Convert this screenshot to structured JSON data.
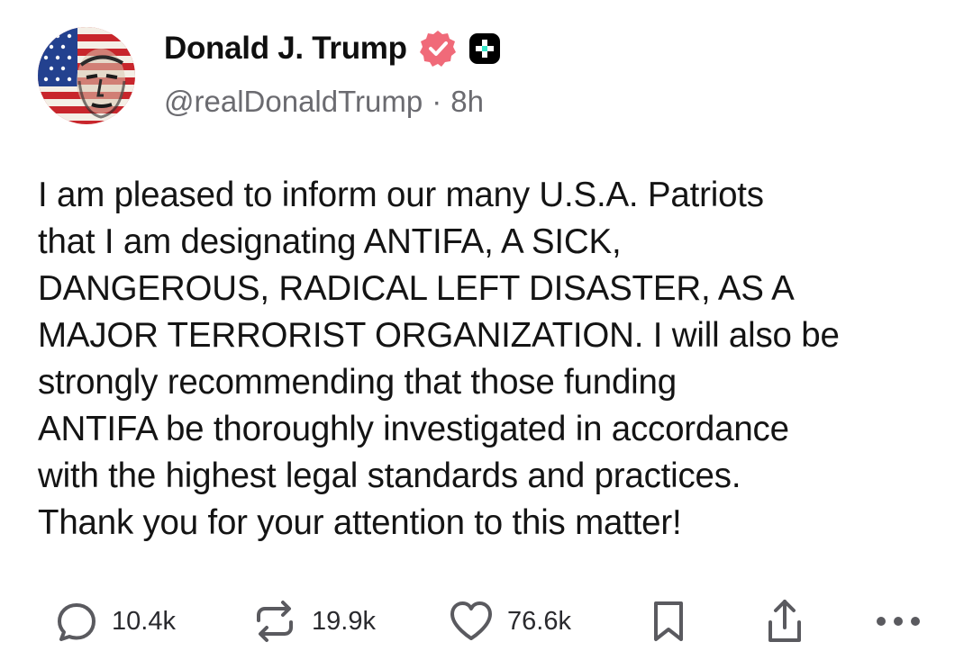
{
  "author": {
    "display_name": "Donald J. Trump",
    "handle": "@realDonaldTrump",
    "separator": "·",
    "time_ago": "8h",
    "verified_badge_color": "#f06a79",
    "plus_badge_color": "#000000",
    "plus_badge_accent": "#35e6c8",
    "avatar_icon": "flag-portrait-avatar"
  },
  "post": {
    "lines": [
      "I am pleased to inform our many U.S.A. Patriots",
      "that I am designating ANTIFA, A SICK,",
      "DANGEROUS, RADICAL LEFT DISASTER, AS A",
      "MAJOR TERRORIST ORGANIZATION. I will also be",
      "strongly recommending that those funding",
      "ANTIFA be thoroughly investigated in accordance",
      "with the highest legal standards and practices.",
      "Thank you for your attention to this matter!"
    ]
  },
  "actions": {
    "reply": {
      "icon": "reply-bubble-icon",
      "count": "10.4k"
    },
    "repost": {
      "icon": "repost-arrows-icon",
      "count": "19.9k"
    },
    "like": {
      "icon": "heart-icon",
      "count": "76.6k"
    },
    "bookmark": {
      "icon": "bookmark-icon"
    },
    "share": {
      "icon": "share-upload-icon"
    },
    "more": {
      "icon": "more-dots-icon"
    }
  },
  "colors": {
    "text": "#141414",
    "muted": "#6b6b70",
    "icon": "#5a5a5f"
  }
}
